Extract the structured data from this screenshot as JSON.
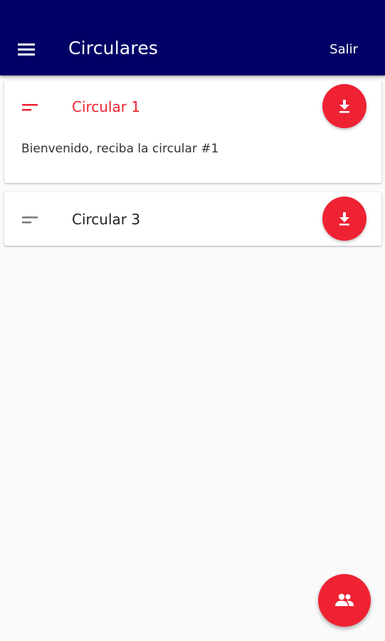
{
  "appbar": {
    "title": "Circulares",
    "logout_label": "Salir",
    "menu_icon": "menu-icon",
    "background_color": "#000066"
  },
  "circulars": [
    {
      "title": "Circular 1",
      "body": "Bienvenido, reciba la circular #1",
      "expanded": true,
      "icon": "short-text-icon",
      "action_icon": "download-icon"
    },
    {
      "title": "Circular 3",
      "expanded": false,
      "icon": "short-text-icon",
      "action_icon": "download-icon"
    }
  ],
  "fab": {
    "icon": "people-icon"
  },
  "colors": {
    "accent": "#ee2233",
    "appbar": "#000066",
    "background": "#fafafa"
  }
}
